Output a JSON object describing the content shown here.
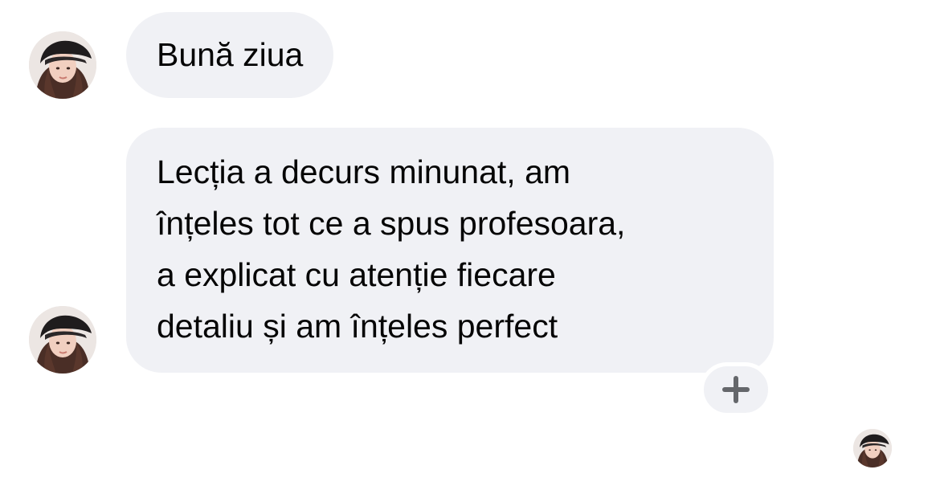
{
  "conversation": {
    "messages": [
      {
        "lines": [
          "Bună ziua"
        ]
      },
      {
        "lines": [
          "Lecția a decurs minunat, am",
          "înțeles tot ce a spus profesoara,",
          "a explicat cu atenție fiecare",
          "detaliu și am înțeles perfect"
        ]
      }
    ],
    "reaction_button": {
      "icon": "plus-icon"
    },
    "read_receipt": {
      "icon": "avatar"
    }
  },
  "colors": {
    "bubble_background": "#f0f1f5",
    "text": "#050505",
    "plus_icon": "#65676b",
    "background": "#ffffff"
  }
}
